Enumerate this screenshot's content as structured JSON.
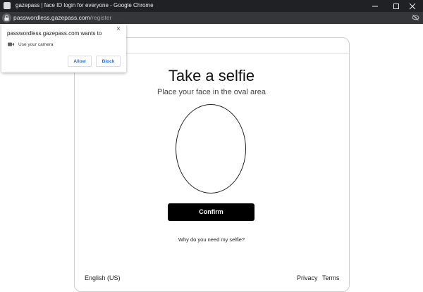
{
  "window": {
    "title": "gazepass | face ID login for everyone - Google Chrome"
  },
  "address_bar": {
    "host": "passwordless.gazepass.com",
    "path": "/register"
  },
  "permission_popup": {
    "message": "passwordless.gazepass.com wants to",
    "close_glyph": "×",
    "request_icon": "camera-icon",
    "request_label": "Use your camera",
    "allow_label": "Allow",
    "block_label": "Block"
  },
  "page": {
    "heading": "Take a selfie",
    "subheading": "Place your face in the oval area",
    "confirm_label": "Confirm",
    "why_link": "Why do you need my selfie?"
  },
  "footer": {
    "language": "English (US)",
    "privacy": "Privacy",
    "terms": "Terms"
  },
  "colors": {
    "titlebar_bg": "#202124",
    "addressbar_bg": "#35363a",
    "button_primary": "#000000",
    "link_blue": "#1a73e8"
  }
}
